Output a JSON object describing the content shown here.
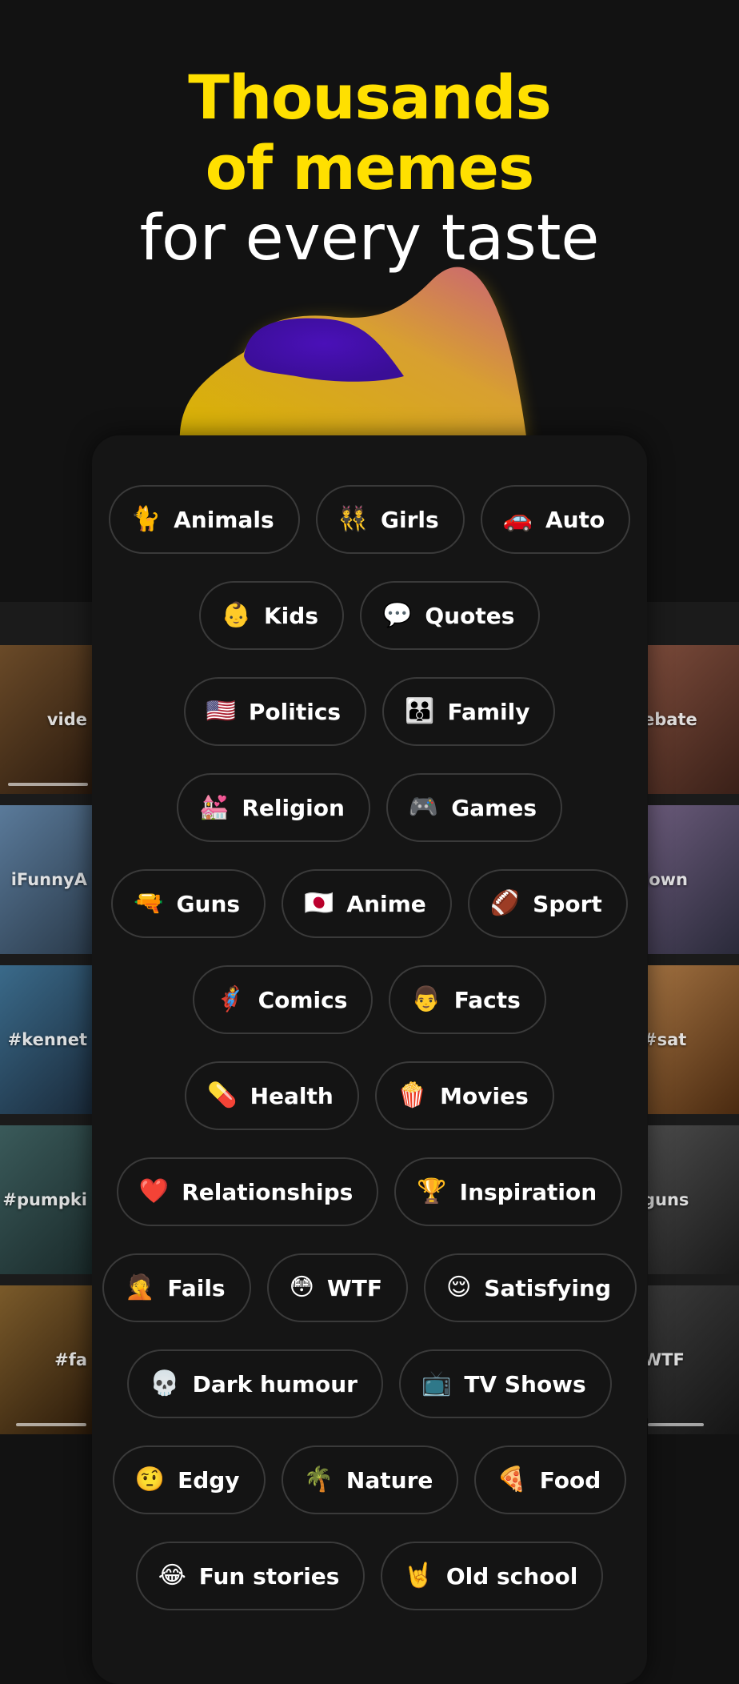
{
  "headline": {
    "line1": "Thousands",
    "line2": "of memes",
    "line3": "for every taste"
  },
  "colors": {
    "accent": "#FFE000",
    "background": "#121212",
    "chip_border": "#3a3a3a",
    "blob_purple": "#4A10B8",
    "blob_yellow": "#E8C400"
  },
  "side_tiles": {
    "left": [
      {
        "tag": "vide",
        "bg": "#5a3a1e"
      },
      {
        "tag": "iFunnyA",
        "bg": "#4a6a8a"
      },
      {
        "tag": "#kennet",
        "bg": "#3a5a7a"
      },
      {
        "tag": "#pumpki",
        "bg": "#2a4a4a"
      },
      {
        "tag": "#fa",
        "bg": "#6a4a2a"
      }
    ],
    "right": [
      {
        "tag": "ebate",
        "bg": "#6a3a2a"
      },
      {
        "tag": "lown",
        "bg": "#5a4a6a"
      },
      {
        "tag": "#sat",
        "bg": "#8a5a2a"
      },
      {
        "tag": "guns",
        "bg": "#3a3a3a"
      },
      {
        "tag": "WTF",
        "bg": "#2a2a2a"
      }
    ]
  },
  "categories": [
    [
      {
        "emoji": "🐈",
        "label": "Animals"
      },
      {
        "emoji": "👯",
        "label": "Girls"
      },
      {
        "emoji": "🚗",
        "label": "Auto"
      }
    ],
    [
      {
        "emoji": "👶",
        "label": "Kids"
      },
      {
        "emoji": "💬",
        "label": "Quotes"
      }
    ],
    [
      {
        "emoji": "🇺🇸",
        "label": "Politics"
      },
      {
        "emoji": "👪",
        "label": "Family"
      }
    ],
    [
      {
        "emoji": "💒",
        "label": "Religion"
      },
      {
        "emoji": "🎮",
        "label": "Games"
      }
    ],
    [
      {
        "emoji": "🔫",
        "label": "Guns"
      },
      {
        "emoji": "🇯🇵",
        "label": "Anime"
      },
      {
        "emoji": "🏈",
        "label": "Sport"
      }
    ],
    [
      {
        "emoji": "🦸",
        "label": "Comics"
      },
      {
        "emoji": "👨",
        "label": "Facts"
      }
    ],
    [
      {
        "emoji": "💊",
        "label": "Health"
      },
      {
        "emoji": "🍿",
        "label": "Movies"
      }
    ],
    [
      {
        "emoji": "❤️",
        "label": "Relationships"
      },
      {
        "emoji": "🏆",
        "label": "Inspiration"
      }
    ],
    [
      {
        "emoji": "🤦",
        "label": "Fails"
      },
      {
        "emoji": "😳",
        "label": "WTF"
      },
      {
        "emoji": "😌",
        "label": "Satisfying"
      }
    ],
    [
      {
        "emoji": "💀",
        "label": "Dark humour"
      },
      {
        "emoji": "📺",
        "label": "TV Shows"
      }
    ],
    [
      {
        "emoji": "🤨",
        "label": "Edgy"
      },
      {
        "emoji": "🌴",
        "label": "Nature"
      },
      {
        "emoji": "🍕",
        "label": "Food"
      }
    ],
    [
      {
        "emoji": "😂",
        "label": "Fun stories"
      },
      {
        "emoji": "🤘",
        "label": "Old school"
      }
    ]
  ]
}
